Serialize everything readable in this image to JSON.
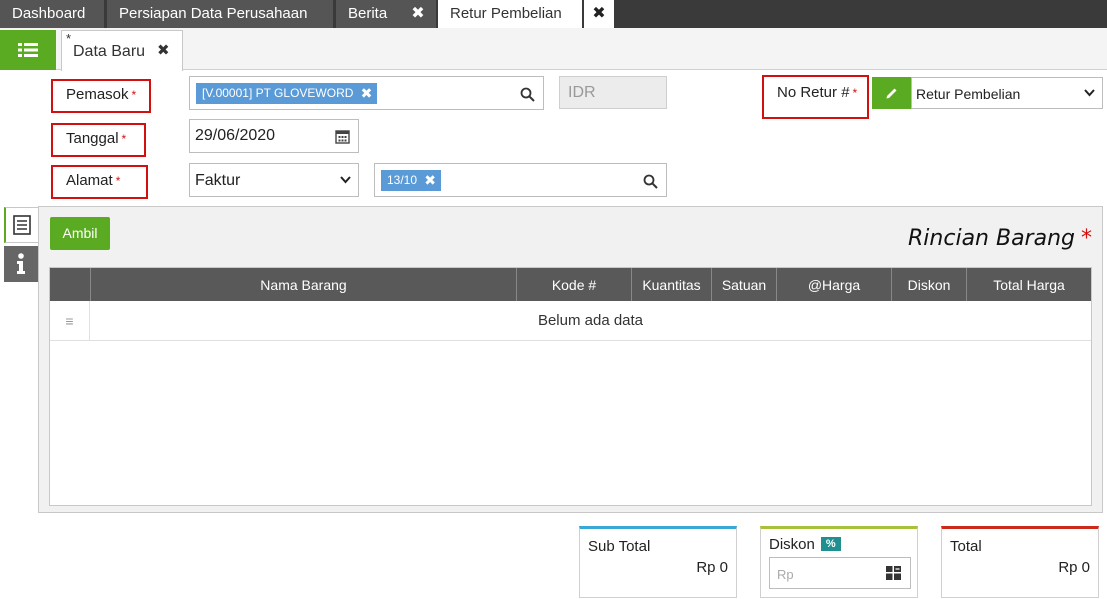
{
  "top_tabs": [
    {
      "label": "Dashboard"
    },
    {
      "label": "Persiapan Data Perusahaan"
    },
    {
      "label": "Berita"
    },
    {
      "label": "Retur Pembelian"
    }
  ],
  "doc_tab": {
    "modified_marker": "*",
    "label": "Data Baru",
    "close": "✖"
  },
  "form": {
    "pemasok_label": "Pemasok",
    "pemasok_value": "[V.00001] PT GLOVEWORD",
    "currency": "IDR",
    "tanggal_label": "Tanggal",
    "tanggal_value": "29/06/2020",
    "alamat_label": "Alamat",
    "alamat_select": "Faktur",
    "alamat_chip": "13/10",
    "no_retur_label": "No Retur #",
    "no_retur_select": "Retur Pembelian",
    "required_mark": "*"
  },
  "panel": {
    "ambil_label": "Ambil",
    "section_title": "Rincian Barang",
    "section_required": "*",
    "columns": [
      "Nama Barang",
      "Kode #",
      "Kuantitas",
      "Satuan",
      "@Harga",
      "Diskon",
      "Total Harga"
    ],
    "empty_text": "Belum ada data"
  },
  "summary": {
    "subtotal_label": "Sub Total",
    "subtotal_value": "Rp 0",
    "diskon_label": "Diskon",
    "diskon_badge": "%",
    "diskon_placeholder": "Rp",
    "total_label": "Total",
    "total_value": "Rp 0"
  },
  "colors": {
    "accent_green": "#5aab22",
    "required_red": "#d21010",
    "chip_blue": "#5a9ad6",
    "subtotal_bar": "#3aa7d4",
    "diskon_bar": "#a6c23a",
    "total_bar": "#cc2a1a"
  },
  "icons": {
    "menu": "list-icon",
    "search": "search-icon",
    "calendar": "calendar-icon",
    "edit": "pencil-icon",
    "details": "document-icon",
    "info": "info-icon",
    "calculator": "calculator-icon"
  }
}
